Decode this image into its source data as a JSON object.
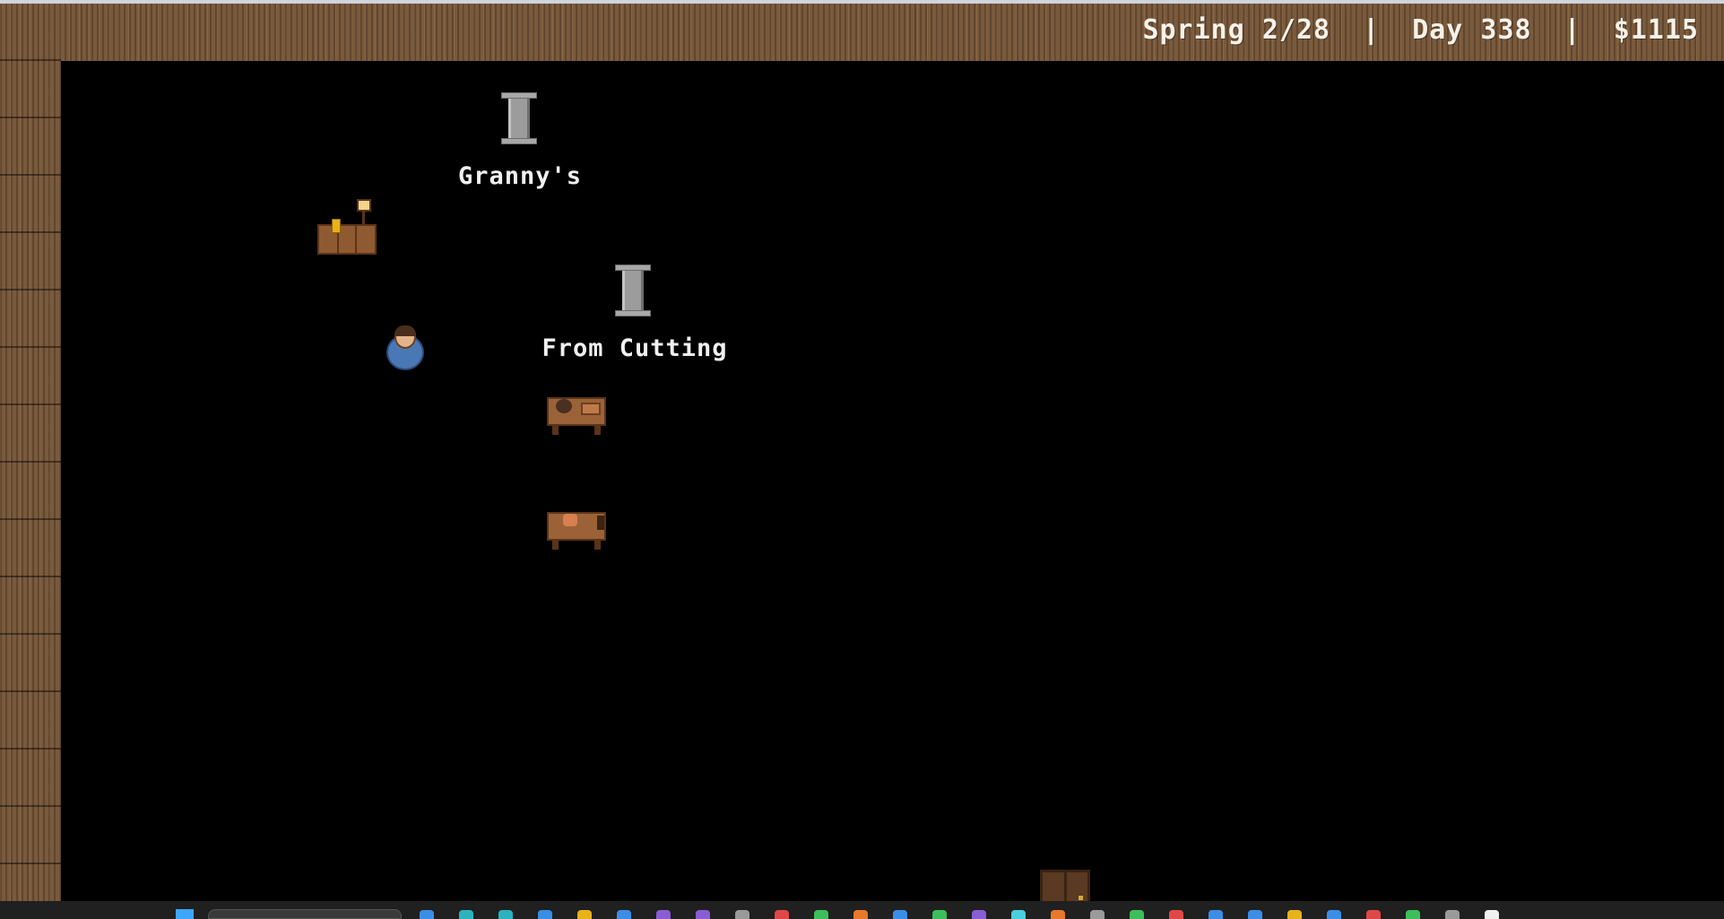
{
  "hud": {
    "season_date": "Spring 2/28",
    "separator": "|",
    "day": "Day 338",
    "money": "$1115"
  },
  "labels": {
    "grannys": "Granny's",
    "from_cutting": "From Cutting"
  },
  "colors": {
    "wood": "#7a5a3c",
    "background": "#000000",
    "hud_text": "#f6f2ea",
    "farmer_shirt": "#4a78b5"
  },
  "taskbar_icons": [
    "blue",
    "teal",
    "teal",
    "blue",
    "yellow",
    "blue",
    "purple",
    "purple",
    "gray",
    "red",
    "green",
    "orange",
    "blue",
    "green",
    "purple",
    "cyan",
    "orange",
    "gray",
    "green",
    "red",
    "blue",
    "blue",
    "yellow",
    "blue",
    "red",
    "green",
    "gray",
    "white"
  ]
}
